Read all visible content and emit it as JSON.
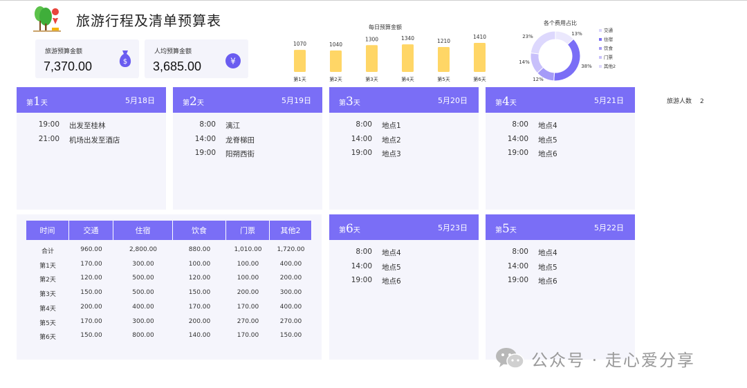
{
  "title": "旅游行程及清单预算表",
  "kpis": [
    {
      "label": "旅游预算金额",
      "value": "7,370.00",
      "icon": "money-bag-icon"
    },
    {
      "label": "人均预算金额",
      "value": "3,685.00",
      "icon": "yen-icon"
    }
  ],
  "colors": {
    "accent": "#7a6ef6",
    "bar": "#ffd666",
    "panel": "#f5f5fc"
  },
  "chart_data": [
    {
      "type": "bar",
      "title": "每日预算金额",
      "categories": [
        "第1天",
        "第2天",
        "第3天",
        "第4天",
        "第5天",
        "第6天"
      ],
      "values": [
        1070,
        1040,
        1300,
        1340,
        1210,
        1410
      ]
    },
    {
      "type": "pie",
      "title": "各个费用占比",
      "categories": [
        "交通",
        "住宿",
        "饮食",
        "门票",
        "其他2"
      ],
      "values": [
        13,
        38,
        12,
        14,
        23
      ],
      "labels": [
        "13%",
        "38%",
        "12%",
        "14%",
        "23%"
      ],
      "colors": [
        "#ebe8fd",
        "#7a6ef6",
        "#a59bf8",
        "#c8c0fb",
        "#ddd8fd"
      ],
      "legend": "right"
    }
  ],
  "days": [
    {
      "num": "1",
      "suffix": "天",
      "prefix": "第",
      "date": "5月18日",
      "items": [
        {
          "time": "19:00",
          "place": "出发至桂林"
        },
        {
          "time": "21:00",
          "place": "机场出发至酒店"
        }
      ]
    },
    {
      "num": "2",
      "suffix": "天",
      "prefix": "第",
      "date": "5月19日",
      "items": [
        {
          "time": "8:00",
          "place": "漓江"
        },
        {
          "time": "14:00",
          "place": "龙脊梯田"
        },
        {
          "time": "19:00",
          "place": "阳朔西街"
        }
      ]
    },
    {
      "num": "3",
      "suffix": "天",
      "prefix": "第",
      "date": "5月20日",
      "items": [
        {
          "time": "8:00",
          "place": "地点1"
        },
        {
          "time": "14:00",
          "place": "地点2"
        },
        {
          "time": "19:00",
          "place": "地点3"
        }
      ]
    },
    {
      "num": "4",
      "suffix": "天",
      "prefix": "第",
      "date": "5月21日",
      "items": [
        {
          "time": "8:00",
          "place": "地点4"
        },
        {
          "time": "14:00",
          "place": "地点5"
        },
        {
          "time": "19:00",
          "place": "地点6"
        }
      ]
    },
    {
      "num": "6",
      "suffix": "天",
      "prefix": "第",
      "date": "5月23日",
      "items": [
        {
          "time": "8:00",
          "place": "地点4"
        },
        {
          "time": "14:00",
          "place": "地点5"
        },
        {
          "time": "19:00",
          "place": "地点6"
        }
      ]
    },
    {
      "num": "5",
      "suffix": "天",
      "prefix": "第",
      "date": "5月22日",
      "items": [
        {
          "time": "8:00",
          "place": "地点4"
        },
        {
          "time": "14:00",
          "place": "地点5"
        },
        {
          "time": "19:00",
          "place": "地点6"
        }
      ]
    }
  ],
  "persons": {
    "label": "旅游人数",
    "value": "2"
  },
  "budget_table": {
    "headers": [
      "时间",
      "交通",
      "住宿",
      "饮食",
      "门票",
      "其他2"
    ],
    "rows": [
      [
        "合计",
        "960.00",
        "2,800.00",
        "880.00",
        "1,010.00",
        "1,720.00"
      ],
      [
        "第1天",
        "170.00",
        "300.00",
        "100.00",
        "100.00",
        "400.00"
      ],
      [
        "第2天",
        "120.00",
        "500.00",
        "120.00",
        "100.00",
        "200.00"
      ],
      [
        "第3天",
        "150.00",
        "500.00",
        "150.00",
        "200.00",
        "300.00"
      ],
      [
        "第4天",
        "200.00",
        "400.00",
        "170.00",
        "170.00",
        "400.00"
      ],
      [
        "第5天",
        "170.00",
        "300.00",
        "200.00",
        "270.00",
        "270.00"
      ],
      [
        "第6天",
        "150.00",
        "800.00",
        "140.00",
        "170.00",
        "150.00"
      ]
    ]
  },
  "watermark": {
    "text": "公众号 · 走心爱分享",
    "icon": "wechat-icon"
  }
}
